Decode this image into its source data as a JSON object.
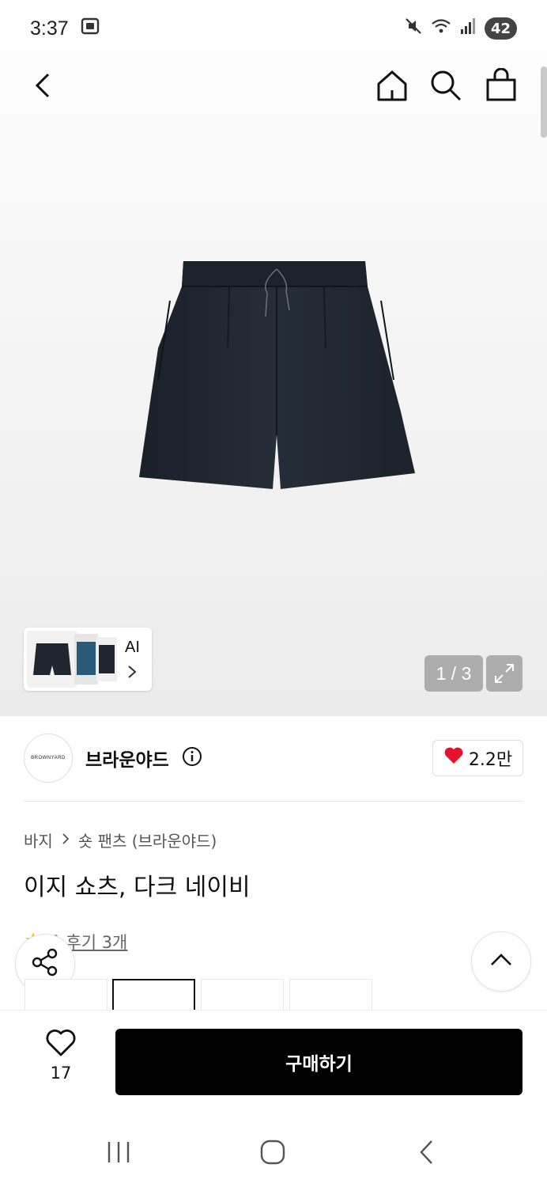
{
  "status_bar": {
    "time": "3:37",
    "battery": "42",
    "icons": [
      "screenshot-icon",
      "mute-icon",
      "wifi-icon",
      "signal-icon"
    ]
  },
  "nav": {
    "icons": [
      "back-icon",
      "home-icon",
      "search-icon",
      "bag-icon"
    ]
  },
  "gallery": {
    "counter": "1 / 3",
    "ai_label": "AI",
    "product_color": "#1f2630"
  },
  "brand": {
    "logo_text": "BROWNYARD",
    "name": "브라운야드",
    "likes": "2.2만"
  },
  "breadcrumb": {
    "category": "바지",
    "subcategory": "숏 팬츠 (브라운야드)"
  },
  "product": {
    "title": "이지 쇼츠, 다크 네이비"
  },
  "rating": {
    "score": "5",
    "review_label": "후기 3개"
  },
  "bottom": {
    "wish_count": "17",
    "buy_label": "구매하기"
  },
  "colors": {
    "buy_button": "#000000",
    "heart": "#e8112d"
  }
}
